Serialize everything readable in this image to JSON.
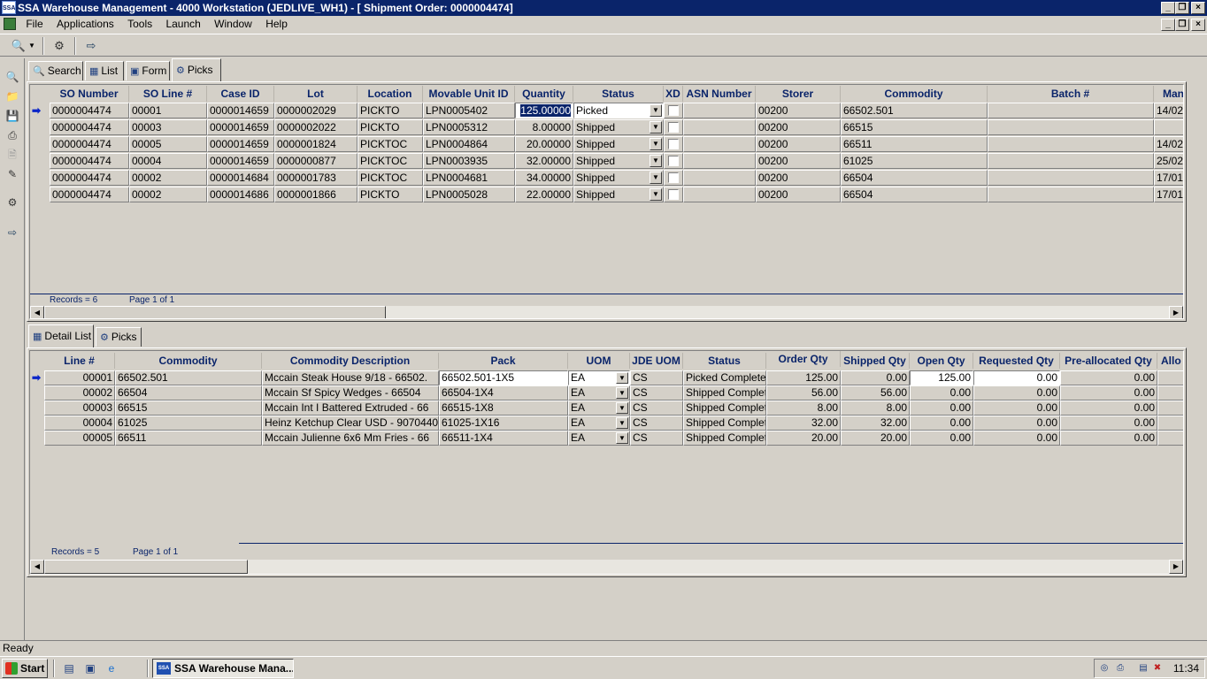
{
  "window": {
    "title": "SSA Warehouse Management - 4000 Workstation (JEDLIVE_WH1) - [ Shipment Order: 0000004474]",
    "app_icon_text": "SSA"
  },
  "menu": [
    "File",
    "Applications",
    "Tools",
    "Launch",
    "Window",
    "Help"
  ],
  "top_tabs": [
    {
      "label": "Search",
      "icon": "search-icon"
    },
    {
      "label": "List",
      "icon": "list-icon"
    },
    {
      "label": "Form",
      "icon": "form-icon"
    },
    {
      "label": "Picks",
      "icon": "picks-icon",
      "active": true
    }
  ],
  "picks_grid": {
    "columns": [
      "SO Number",
      "SO Line #",
      "Case ID",
      "Lot",
      "Location",
      "Movable Unit ID",
      "Quantity",
      "Status",
      "XD",
      "ASN Number",
      "Storer",
      "Commodity",
      "Batch #",
      "Man"
    ],
    "rows": [
      {
        "so": "0000004474",
        "line": "00001",
        "case": "0000014659",
        "lot": "0000002029",
        "loc": "PICKTO",
        "mu": "LPN0005402",
        "qty": "125.00000",
        "status": "Picked",
        "storer": "00200",
        "commodity": "66502.501",
        "batch": "",
        "man": "14/02"
      },
      {
        "so": "0000004474",
        "line": "00003",
        "case": "0000014659",
        "lot": "0000002022",
        "loc": "PICKTO",
        "mu": "LPN0005312",
        "qty": "8.00000",
        "status": "Shipped",
        "storer": "00200",
        "commodity": "66515",
        "batch": "",
        "man": ""
      },
      {
        "so": "0000004474",
        "line": "00005",
        "case": "0000014659",
        "lot": "0000001824",
        "loc": "PICKTOC",
        "mu": "LPN0004864",
        "qty": "20.00000",
        "status": "Shipped",
        "storer": "00200",
        "commodity": "66511",
        "batch": "",
        "man": "14/02"
      },
      {
        "so": "0000004474",
        "line": "00004",
        "case": "0000014659",
        "lot": "0000000877",
        "loc": "PICKTOC",
        "mu": "LPN0003935",
        "qty": "32.00000",
        "status": "Shipped",
        "storer": "00200",
        "commodity": "61025",
        "batch": "",
        "man": "25/02"
      },
      {
        "so": "0000004474",
        "line": "00002",
        "case": "0000014684",
        "lot": "0000001783",
        "loc": "PICKTOC",
        "mu": "LPN0004681",
        "qty": "34.00000",
        "status": "Shipped",
        "storer": "00200",
        "commodity": "66504",
        "batch": "",
        "man": "17/01"
      },
      {
        "so": "0000004474",
        "line": "00002",
        "case": "0000014686",
        "lot": "0000001866",
        "loc": "PICKTO",
        "mu": "LPN0005028",
        "qty": "22.00000",
        "status": "Shipped",
        "storer": "00200",
        "commodity": "66504",
        "batch": "",
        "man": "17/01"
      }
    ],
    "records": "Records = 6",
    "page": "Page 1 of 1"
  },
  "bottom_tabs": [
    {
      "label": "Detail List",
      "icon": "detail-list-icon",
      "active": true
    },
    {
      "label": "Picks",
      "icon": "picks-icon"
    }
  ],
  "detail_grid": {
    "columns": [
      "Line #",
      "Commodity",
      "Commodity Description",
      "Pack",
      "UOM",
      "JDE UOM",
      "Status",
      "Order Qty",
      "Shipped Qty",
      "Open Qty",
      "Requested Qty",
      "Pre-allocated Qty",
      "Allo"
    ],
    "rows": [
      {
        "line": "00001",
        "commodity": "66502.501",
        "desc": "Mccain Steak House 9/18 - 66502.",
        "pack": "66502.501-1X5",
        "uom": "EA",
        "jde": "CS",
        "status": "Picked Complete",
        "order": "125.00",
        "shipped": "0.00",
        "open": "125.00",
        "requested": "0.00",
        "prealloc": "0.00"
      },
      {
        "line": "00002",
        "commodity": "66504",
        "desc": "Mccain Sf Spicy Wedges - 66504",
        "pack": "66504-1X4",
        "uom": "EA",
        "jde": "CS",
        "status": "Shipped Complete",
        "order": "56.00",
        "shipped": "56.00",
        "open": "0.00",
        "requested": "0.00",
        "prealloc": "0.00"
      },
      {
        "line": "00003",
        "commodity": "66515",
        "desc": "Mccain Int I Battered Extruded - 66",
        "pack": "66515-1X8",
        "uom": "EA",
        "jde": "CS",
        "status": "Shipped Complete",
        "order": "8.00",
        "shipped": "8.00",
        "open": "0.00",
        "requested": "0.00",
        "prealloc": "0.00"
      },
      {
        "line": "00004",
        "commodity": "61025",
        "desc": "Heinz Ketchup Clear USD - 9070440",
        "pack": "61025-1X16",
        "uom": "EA",
        "jde": "CS",
        "status": "Shipped Complete",
        "order": "32.00",
        "shipped": "32.00",
        "open": "0.00",
        "requested": "0.00",
        "prealloc": "0.00"
      },
      {
        "line": "00005",
        "commodity": "66511",
        "desc": "Mccain Julienne 6x6 Mm Fries - 66",
        "pack": "66511-1X4",
        "uom": "EA",
        "jde": "CS",
        "status": "Shipped Complete",
        "order": "20.00",
        "shipped": "20.00",
        "open": "0.00",
        "requested": "0.00",
        "prealloc": "0.00"
      }
    ],
    "records": "Records = 5",
    "page": "Page 1 of 1"
  },
  "status_bar": "Ready",
  "taskbar": {
    "start": "Start",
    "task": "SSA Warehouse Mana...",
    "task_icon_text": "SSA",
    "clock": "11:34"
  }
}
